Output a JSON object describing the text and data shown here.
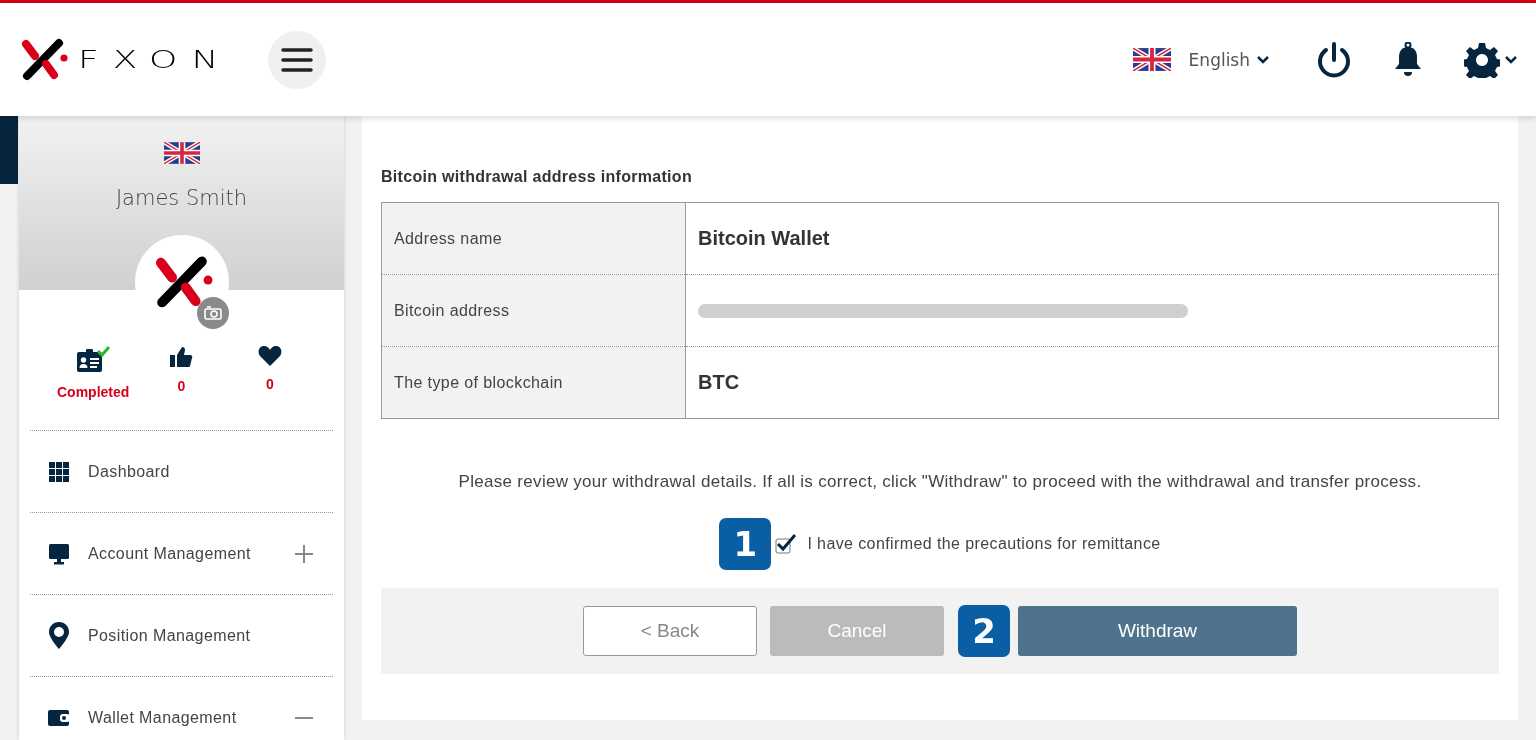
{
  "header": {
    "logo_text": "FXON",
    "language": "English"
  },
  "profile": {
    "name": "James Smith",
    "stats": [
      {
        "kind": "verification",
        "value": "Completed"
      },
      {
        "kind": "likes",
        "value": "0"
      },
      {
        "kind": "favorites",
        "value": "0"
      }
    ]
  },
  "menu": [
    {
      "label": "Dashboard",
      "kind": "link"
    },
    {
      "label": "Account Management",
      "kind": "group",
      "expanded": false
    },
    {
      "label": "Position Management",
      "kind": "link"
    },
    {
      "label": "Wallet Management",
      "kind": "group",
      "expanded": true
    }
  ],
  "main": {
    "section_title": "Bitcoin withdrawal address information",
    "rows": [
      {
        "label": "Address name",
        "kind": "text",
        "value": "Bitcoin Wallet"
      },
      {
        "label": "Bitcoin address",
        "kind": "redacted"
      },
      {
        "label": "The type of blockchain",
        "kind": "text",
        "value": "BTC"
      }
    ],
    "notice": "Please review your withdrawal details. If all is correct, click \"Withdraw\" to proceed with the withdrawal and transfer process.",
    "confirm": {
      "label": "I have confirmed the precautions for remittance",
      "checked": true
    },
    "step_markers": [
      "1",
      "2"
    ],
    "buttons": [
      {
        "label": "< Back",
        "kind": "outline"
      },
      {
        "label": "Cancel",
        "kind": "disabled"
      },
      {
        "label": "Withdraw",
        "kind": "primary"
      }
    ]
  }
}
